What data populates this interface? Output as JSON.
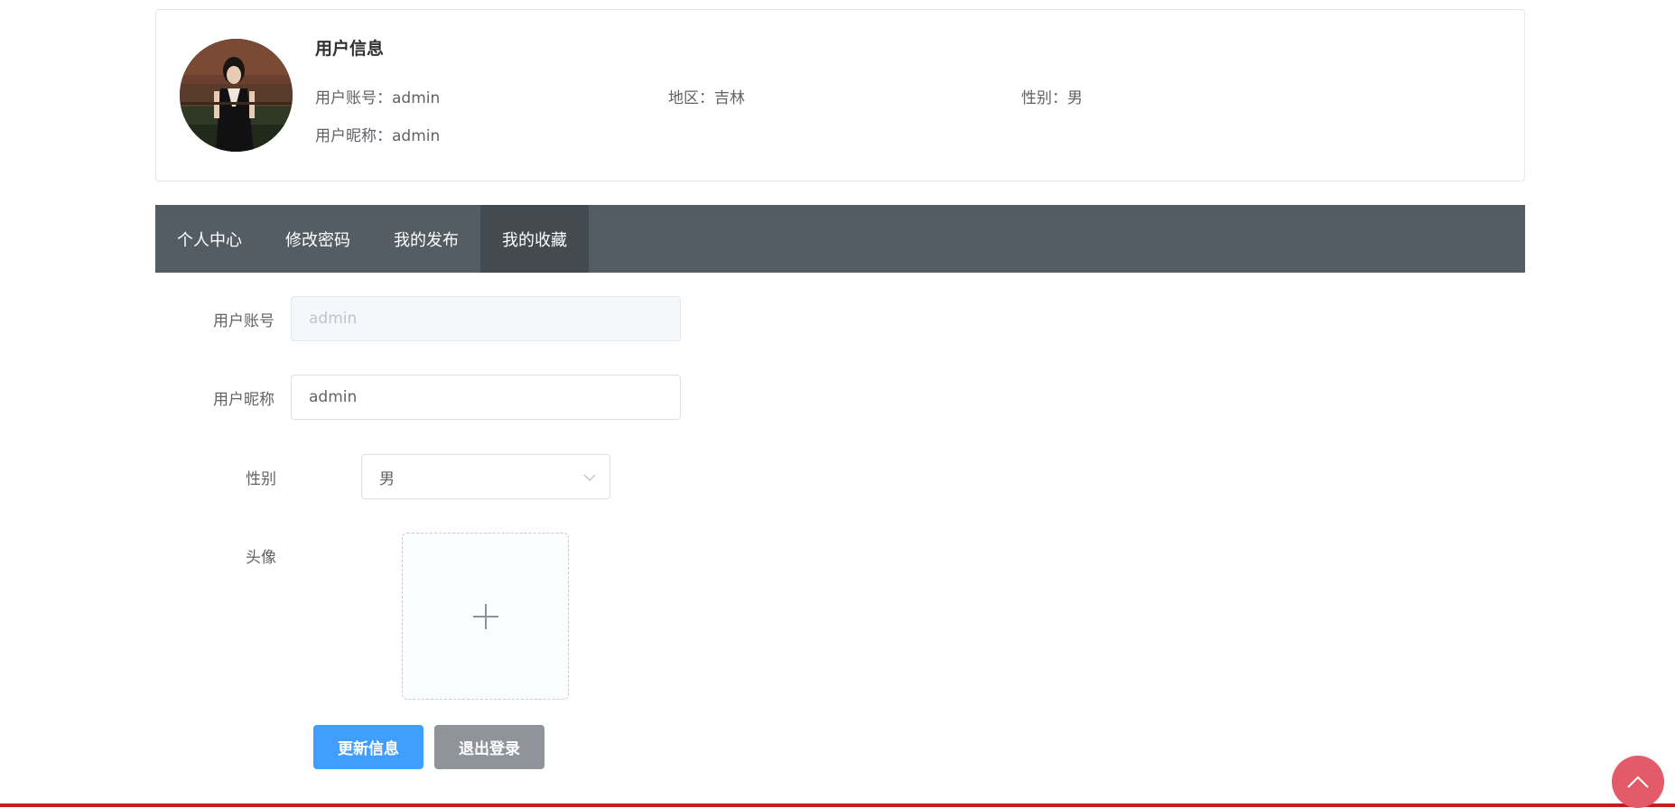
{
  "profile": {
    "title": "用户信息",
    "account_label": "用户账号：",
    "account_value": "admin",
    "region_label": "地区：",
    "region_value": "吉林",
    "gender_label": "性别：",
    "gender_value": "男",
    "nickname_label": "用户昵称：",
    "nickname_value": "admin"
  },
  "tabs": [
    {
      "label": "个人中心"
    },
    {
      "label": "修改密码"
    },
    {
      "label": "我的发布"
    },
    {
      "label": "我的收藏",
      "active": true
    }
  ],
  "form": {
    "account_label": "用户账号",
    "account_value": "admin",
    "nickname_label": "用户昵称",
    "nickname_value": "admin",
    "gender_label": "性别",
    "gender_value": "男",
    "avatar_label": "头像"
  },
  "buttons": {
    "update": "更新信息",
    "logout": "退出登录"
  },
  "icons": {
    "upload": "plus-icon",
    "select": "chevron-down-icon",
    "back_to_top": "chevron-up-icon"
  },
  "colors": {
    "tab_bar": "#545c64",
    "tab_active": "#434a50",
    "primary": "#409eff",
    "info": "#909399",
    "back_to_top": "#e35b68",
    "bottom_line": "#c11e22"
  }
}
